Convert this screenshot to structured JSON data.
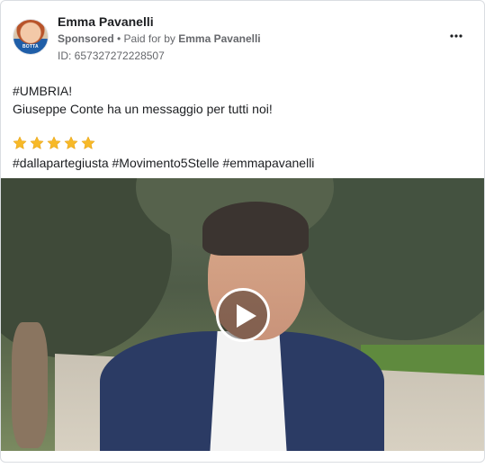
{
  "post": {
    "page_name": "Emma Pavanelli",
    "sponsored_label": "Sponsored",
    "separator": " • ",
    "paid_for_prefix": "Paid for by ",
    "paid_for_name": "Emma Pavanelli",
    "ad_id": "ID: 657327272228507",
    "avatar_badge": "BOTTA",
    "body_line_1": "#UMBRIA!",
    "body_line_2": "Giuseppe Conte ha un messaggio per tutti noi!",
    "stars_count": 5,
    "hashtags": "#dallapartegiusta #Movimento5Stelle #emmapavanelli"
  },
  "icons": {
    "more": "more-options-icon",
    "star": "star-emoji-icon",
    "play": "play-icon"
  },
  "colors": {
    "star": "#f7b928",
    "meta_text": "#65676b",
    "border": "#dadde1"
  }
}
